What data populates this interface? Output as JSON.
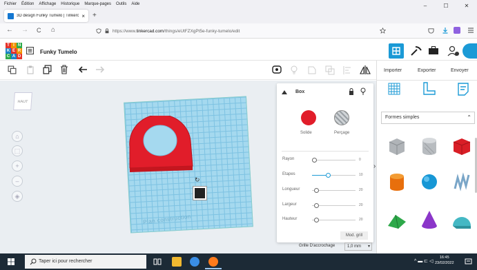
{
  "menu": [
    "Fichier",
    "Édition",
    "Affichage",
    "Historique",
    "Marque-pages",
    "Outils",
    "Aide"
  ],
  "tab": {
    "title": "3D design Funky Tumelo | Tinkercad",
    "close": "×",
    "new": "+"
  },
  "window": {
    "minimize": "–",
    "maximize": "☐",
    "close": "✕"
  },
  "nav": {
    "back": "←",
    "forward": "→",
    "reload": "C",
    "home": "⌂"
  },
  "url": {
    "prefix": "https://www.",
    "host": "tinkercad.com",
    "path": "/things/eUtFZXgPt5e-funky-tumelo/edit"
  },
  "app": {
    "logo_letters": [
      "T",
      "I",
      "N",
      "K",
      "E",
      "R",
      "C",
      "A",
      "D"
    ],
    "title": "Funky Tumelo"
  },
  "actions": {
    "import": "Importer",
    "export": "Exporter",
    "send": "Envoyer"
  },
  "view_cube": "HAUT",
  "workplane_label": "Plan construction",
  "inspector": {
    "title": "Box",
    "solid_label": "Solide",
    "hole_label": "Perçage",
    "properties": [
      {
        "name": "Rayon",
        "value": "0",
        "level": 0.0
      },
      {
        "name": "Etapes",
        "value": "10",
        "level": 0.35
      },
      {
        "name": "Longueur",
        "value": "20",
        "level": 0.05
      },
      {
        "name": "Largeur",
        "value": "20",
        "level": 0.05
      },
      {
        "name": "Hauteur",
        "value": "20",
        "level": 0.05
      }
    ],
    "mod_grid": "Mod. grill",
    "snap_label": "Grille D'accrochage",
    "snap_value": "1,0 mm"
  },
  "library": {
    "selected": "Formes simples"
  },
  "taskbar": {
    "search_placeholder": "Taper ici pour rechercher",
    "time": "16:45",
    "date": "23/02/2022"
  },
  "colors": {
    "accent": "#1b9ad6",
    "solid": "#e11d2a",
    "workplane": "#a5d9ef",
    "taskbar": "#1c2a36"
  }
}
